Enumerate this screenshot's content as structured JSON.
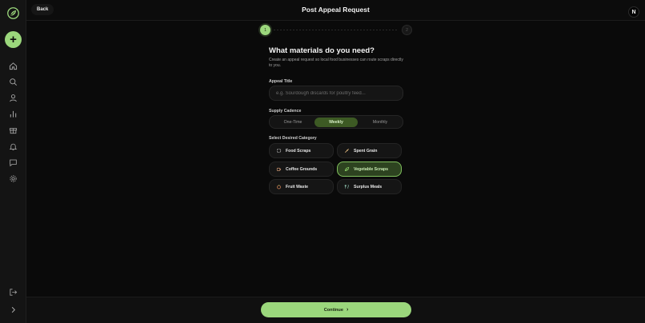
{
  "header": {
    "back_label": "Back",
    "title": "Post Appeal Request",
    "avatar_initial": "N"
  },
  "sidebar": {
    "items": [
      {
        "icon": "home-icon"
      },
      {
        "icon": "search-icon"
      },
      {
        "icon": "user-icon"
      },
      {
        "icon": "chart-icon"
      },
      {
        "icon": "gift-icon"
      },
      {
        "icon": "bell-icon"
      },
      {
        "icon": "message-icon"
      },
      {
        "icon": "gear-icon"
      }
    ],
    "bottom": [
      {
        "icon": "logout-icon"
      },
      {
        "icon": "chevron-right-icon"
      }
    ],
    "add_label": "+"
  },
  "stepper": {
    "steps": [
      "1",
      "2"
    ],
    "current": 1
  },
  "form": {
    "heading": "What materials do you need?",
    "description": "Create an appeal request so local food businesses can route scraps directly to you.",
    "title_label": "Appeal Title",
    "title_placeholder": "e.g. Sourdough discards for poultry feed...",
    "title_value": "",
    "cadence_label": "Supply Cadence",
    "cadence_options": [
      "One-Time",
      "Weekly",
      "Monthly"
    ],
    "cadence_selected": "Weekly",
    "category_label": "Select Desired Category",
    "categories": [
      {
        "label": "Food Scraps",
        "icon": "recycle-icon",
        "selected": false
      },
      {
        "label": "Spent Grain",
        "icon": "wheat-icon",
        "selected": false
      },
      {
        "label": "Coffee Grounds",
        "icon": "coffee-icon",
        "selected": false
      },
      {
        "label": "Vegetable Scraps",
        "icon": "leaf-icon",
        "selected": true
      },
      {
        "label": "Fruit Waste",
        "icon": "fruit-icon",
        "selected": false
      },
      {
        "label": "Surplus Meals",
        "icon": "meal-icon",
        "selected": false
      }
    ]
  },
  "footer": {
    "continue_label": "Continue"
  },
  "colors": {
    "accent": "#9bd77c",
    "accent_dark": "#3d5a24",
    "background": "#0a0a0a"
  }
}
